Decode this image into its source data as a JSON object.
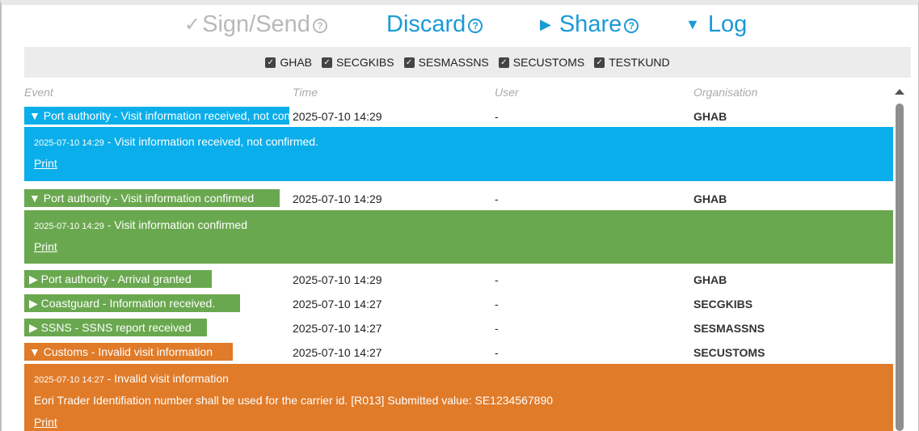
{
  "actions": {
    "sign": "Sign/Send",
    "discard": "Discard",
    "share": "Share",
    "log": "Log",
    "help": "?"
  },
  "filters": [
    "GHAB",
    "SECGKIBS",
    "SESMASSNS",
    "SECUSTOMS",
    "TESTKUND"
  ],
  "table": {
    "headers": {
      "event": "Event",
      "time": "Time",
      "user": "User",
      "organisation": "Organisation"
    },
    "rows": [
      {
        "event": "▼ Port authority - Visit information received, not confirmed.",
        "time": "2025-07-10 14:29",
        "user": "-",
        "org": "GHAB"
      },
      {
        "event": "▼ Port authority - Visit information confirmed",
        "time": "2025-07-10 14:29",
        "user": "-",
        "org": "GHAB"
      },
      {
        "event": "▶ Port authority - Arrival granted",
        "time": "2025-07-10 14:29",
        "user": "-",
        "org": "GHAB"
      },
      {
        "event": "▶ Coastguard - Information received.",
        "time": "2025-07-10 14:27",
        "user": "-",
        "org": "SECGKIBS"
      },
      {
        "event": "▶ SSNS - SSNS report received",
        "time": "2025-07-10 14:27",
        "user": "-",
        "org": "SESMASSNS"
      },
      {
        "event": "▼ Customs - Invalid visit information",
        "time": "2025-07-10 14:27",
        "user": "-",
        "org": "SECUSTOMS"
      }
    ],
    "details": [
      {
        "ts": "2025-07-10 14:29",
        "text": " - Visit information received, not confirmed.",
        "print": "Print"
      },
      {
        "ts": "2025-07-10 14:29",
        "text": " - Visit information confirmed",
        "print": "Print"
      },
      {
        "ts": "2025-07-10 14:27",
        "text": " - Invalid visit information",
        "extra": "Eori Trader Identifiation number shall be used for the carrier id. [R013] Submitted value: SE1234567890",
        "print": "Print"
      }
    ]
  },
  "colors": {
    "blue": "#0aaeea",
    "green": "#6aa84f",
    "orange": "#e07b29",
    "accent": "#1a9ad6"
  }
}
